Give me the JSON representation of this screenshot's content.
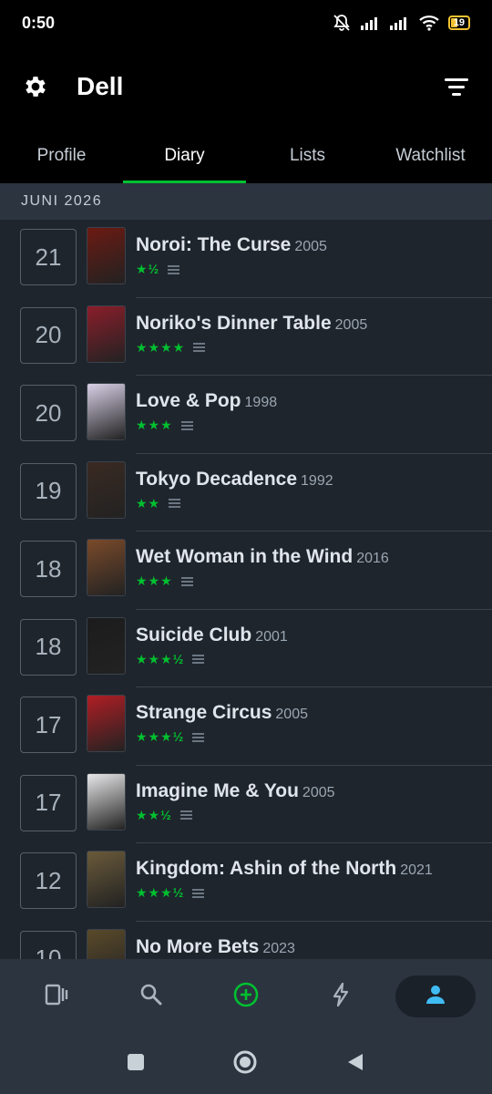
{
  "status_bar": {
    "time": "0:50",
    "battery": "19"
  },
  "header": {
    "title": "Dell"
  },
  "tabs": [
    {
      "label": "Profile"
    },
    {
      "label": "Diary"
    },
    {
      "label": "Lists"
    },
    {
      "label": "Watchlist"
    }
  ],
  "active_tab": "Diary",
  "month": "JUNI 2026",
  "entries": [
    {
      "day": "21",
      "title": "Noroi: The Curse",
      "year": "2005",
      "stars": "★½",
      "poster_color": "#6b1a12"
    },
    {
      "day": "20",
      "title": "Noriko's Dinner Table",
      "year": "2005",
      "stars": "★★★★",
      "poster_color": "#8a1e2a"
    },
    {
      "day": "20",
      "title": "Love & Pop",
      "year": "1998",
      "stars": "★★★",
      "poster_color": "#d8d0e6"
    },
    {
      "day": "19",
      "title": "Tokyo Decadence",
      "year": "1992",
      "stars": "★★",
      "poster_color": "#3a2a22"
    },
    {
      "day": "18",
      "title": "Wet Woman in the Wind",
      "year": "2016",
      "stars": "★★★",
      "poster_color": "#7a4a2a"
    },
    {
      "day": "18",
      "title": "Suicide Club",
      "year": "2001",
      "stars": "★★★½",
      "poster_color": "#1c1c1c"
    },
    {
      "day": "17",
      "title": "Strange Circus",
      "year": "2005",
      "stars": "★★★½",
      "poster_color": "#b01e24"
    },
    {
      "day": "17",
      "title": "Imagine Me & You",
      "year": "2005",
      "stars": "★★½",
      "poster_color": "#e8e8ea"
    },
    {
      "day": "12",
      "title": "Kingdom: Ashin of the North",
      "year": "2021",
      "stars": "★★★½",
      "poster_color": "#6a5a3a"
    },
    {
      "day": "10",
      "title": "No More Bets",
      "year": "2023",
      "stars": "",
      "poster_color": "#5a4a2a"
    }
  ],
  "colors": {
    "accent_green": "#00c030",
    "active_nav_blue": "#40bcf4",
    "plus_green": "#00c030"
  }
}
